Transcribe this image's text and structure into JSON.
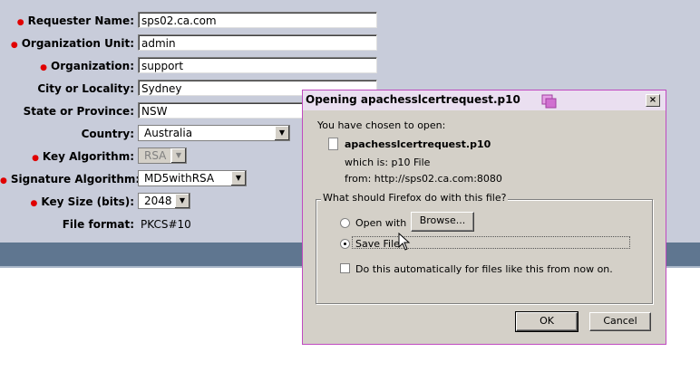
{
  "form": {
    "rows": [
      {
        "label": "Requester Name:",
        "required": true,
        "type": "text",
        "value": "sps02.ca.com"
      },
      {
        "label": "Organization Unit:",
        "required": true,
        "type": "text",
        "value": "admin"
      },
      {
        "label": "Organization:",
        "required": true,
        "type": "text",
        "value": "support"
      },
      {
        "label": "City or Locality:",
        "required": false,
        "type": "text",
        "value": "Sydney"
      },
      {
        "label": "State or Province:",
        "required": false,
        "type": "text",
        "value": "NSW"
      },
      {
        "label": "Country:",
        "required": false,
        "type": "select",
        "value": "Australia"
      },
      {
        "label": "Key Algorithm:",
        "required": true,
        "type": "select-disabled",
        "value": "RSA"
      },
      {
        "label": "Signature Algorithm:",
        "required": true,
        "type": "select",
        "value": "MD5withRSA"
      },
      {
        "label": "Key Size (bits):",
        "required": true,
        "type": "select",
        "value": "2048"
      },
      {
        "label": "File format:",
        "required": false,
        "type": "static",
        "value": "PKCS#10"
      }
    ]
  },
  "dialog": {
    "title": "Opening apachesslcertrequest.p10",
    "close_label": "×",
    "chosen_text": "You have chosen to open:",
    "filename": "apachesslcertrequest.p10",
    "which_is": "which is:  p10 File",
    "from": "from:  http://sps02.ca.com:8080",
    "question": "What should Firefox do with this file?",
    "open_with_label": "Open with",
    "browse_label": "Browse...",
    "save_file_label": "Save File",
    "auto_label": "Do this automatically for files like this from now on.",
    "ok_label": "OK",
    "cancel_label": "Cancel",
    "selected_option": "save_file",
    "auto_checked": false
  },
  "colors": {
    "required_marker": "#e00000",
    "top_background": "#c8ccda",
    "band": "#5f7690",
    "dialog_border": "#c04ac0"
  }
}
